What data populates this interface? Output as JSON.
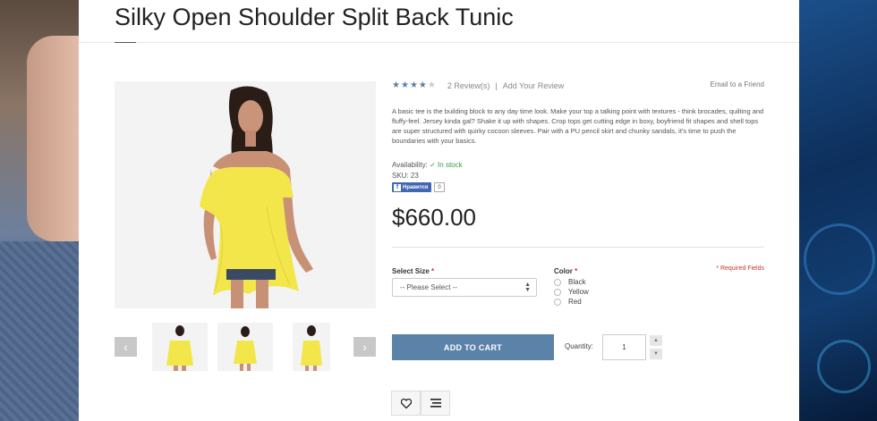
{
  "product": {
    "title": "Silky Open Shoulder Split Back Tunic",
    "rating_stars": 3.5,
    "rating_max": 5,
    "reviews_link": "2 Review(s)",
    "separator": "|",
    "add_review": "Add Your Review",
    "email_friend": "Email to a Friend",
    "description": "A basic tee is the building block to any day time look. Make your top a talking point with textures - think brocades, quilting and fluffy-feel. Jersey kinda gal? Shake it up with shapes. Crop tops get cutting edge in boxy, boyfriend fit shapes and shell tops are super structured with quirky cocoon sleeves. Pair with a PU pencil skirt and chunky sandals, it's time to push the boundaries with your basics.",
    "availability_label": "Availability:",
    "availability_value": "In stock",
    "sku": "SKU: 23",
    "like_label": "Нравится",
    "like_count": "0",
    "price": "$660.00"
  },
  "options": {
    "size_label": "Select Size",
    "size_placeholder": "-- Please Select --",
    "color_label": "Color",
    "required_mark": "*",
    "required_note": "* Required Fields",
    "colors": [
      "Black",
      "Yellow",
      "Red"
    ]
  },
  "cart": {
    "add_label": "ADD TO CART",
    "qty_label": "Quantity:",
    "qty_value": "1"
  },
  "gallery": {
    "prev": "‹",
    "next": "›"
  },
  "colors": {
    "accent": "#5b82a8",
    "stock": "#3a9a4a",
    "required": "#c0392b",
    "dress": "#f2e64a"
  },
  "icons": [
    "star-icon",
    "check-icon",
    "facebook-icon",
    "chevron-left-icon",
    "chevron-right-icon",
    "heart-icon",
    "compare-icon"
  ]
}
